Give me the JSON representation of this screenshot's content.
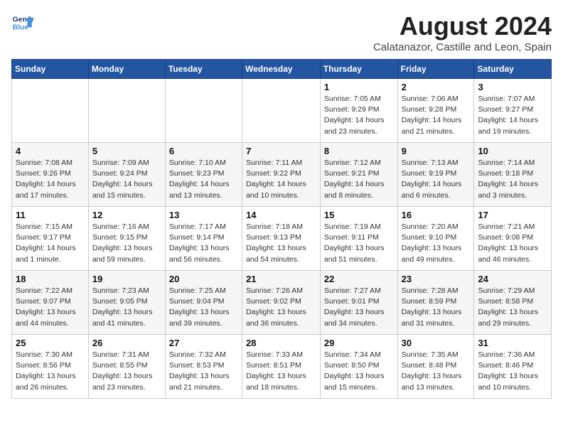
{
  "header": {
    "logo_line1": "General",
    "logo_line2": "Blue",
    "month_year": "August 2024",
    "location": "Calatanazor, Castille and Leon, Spain"
  },
  "weekdays": [
    "Sunday",
    "Monday",
    "Tuesday",
    "Wednesday",
    "Thursday",
    "Friday",
    "Saturday"
  ],
  "weeks": [
    [
      {
        "day": "",
        "info": ""
      },
      {
        "day": "",
        "info": ""
      },
      {
        "day": "",
        "info": ""
      },
      {
        "day": "",
        "info": ""
      },
      {
        "day": "1",
        "info": "Sunrise: 7:05 AM\nSunset: 9:29 PM\nDaylight: 14 hours\nand 23 minutes."
      },
      {
        "day": "2",
        "info": "Sunrise: 7:06 AM\nSunset: 9:28 PM\nDaylight: 14 hours\nand 21 minutes."
      },
      {
        "day": "3",
        "info": "Sunrise: 7:07 AM\nSunset: 9:27 PM\nDaylight: 14 hours\nand 19 minutes."
      }
    ],
    [
      {
        "day": "4",
        "info": "Sunrise: 7:08 AM\nSunset: 9:26 PM\nDaylight: 14 hours\nand 17 minutes."
      },
      {
        "day": "5",
        "info": "Sunrise: 7:09 AM\nSunset: 9:24 PM\nDaylight: 14 hours\nand 15 minutes."
      },
      {
        "day": "6",
        "info": "Sunrise: 7:10 AM\nSunset: 9:23 PM\nDaylight: 14 hours\nand 13 minutes."
      },
      {
        "day": "7",
        "info": "Sunrise: 7:11 AM\nSunset: 9:22 PM\nDaylight: 14 hours\nand 10 minutes."
      },
      {
        "day": "8",
        "info": "Sunrise: 7:12 AM\nSunset: 9:21 PM\nDaylight: 14 hours\nand 8 minutes."
      },
      {
        "day": "9",
        "info": "Sunrise: 7:13 AM\nSunset: 9:19 PM\nDaylight: 14 hours\nand 6 minutes."
      },
      {
        "day": "10",
        "info": "Sunrise: 7:14 AM\nSunset: 9:18 PM\nDaylight: 14 hours\nand 3 minutes."
      }
    ],
    [
      {
        "day": "11",
        "info": "Sunrise: 7:15 AM\nSunset: 9:17 PM\nDaylight: 14 hours\nand 1 minute."
      },
      {
        "day": "12",
        "info": "Sunrise: 7:16 AM\nSunset: 9:15 PM\nDaylight: 13 hours\nand 59 minutes."
      },
      {
        "day": "13",
        "info": "Sunrise: 7:17 AM\nSunset: 9:14 PM\nDaylight: 13 hours\nand 56 minutes."
      },
      {
        "day": "14",
        "info": "Sunrise: 7:18 AM\nSunset: 9:13 PM\nDaylight: 13 hours\nand 54 minutes."
      },
      {
        "day": "15",
        "info": "Sunrise: 7:19 AM\nSunset: 9:11 PM\nDaylight: 13 hours\nand 51 minutes."
      },
      {
        "day": "16",
        "info": "Sunrise: 7:20 AM\nSunset: 9:10 PM\nDaylight: 13 hours\nand 49 minutes."
      },
      {
        "day": "17",
        "info": "Sunrise: 7:21 AM\nSunset: 9:08 PM\nDaylight: 13 hours\nand 46 minutes."
      }
    ],
    [
      {
        "day": "18",
        "info": "Sunrise: 7:22 AM\nSunset: 9:07 PM\nDaylight: 13 hours\nand 44 minutes."
      },
      {
        "day": "19",
        "info": "Sunrise: 7:23 AM\nSunset: 9:05 PM\nDaylight: 13 hours\nand 41 minutes."
      },
      {
        "day": "20",
        "info": "Sunrise: 7:25 AM\nSunset: 9:04 PM\nDaylight: 13 hours\nand 39 minutes."
      },
      {
        "day": "21",
        "info": "Sunrise: 7:26 AM\nSunset: 9:02 PM\nDaylight: 13 hours\nand 36 minutes."
      },
      {
        "day": "22",
        "info": "Sunrise: 7:27 AM\nSunset: 9:01 PM\nDaylight: 13 hours\nand 34 minutes."
      },
      {
        "day": "23",
        "info": "Sunrise: 7:28 AM\nSunset: 8:59 PM\nDaylight: 13 hours\nand 31 minutes."
      },
      {
        "day": "24",
        "info": "Sunrise: 7:29 AM\nSunset: 8:58 PM\nDaylight: 13 hours\nand 29 minutes."
      }
    ],
    [
      {
        "day": "25",
        "info": "Sunrise: 7:30 AM\nSunset: 8:56 PM\nDaylight: 13 hours\nand 26 minutes."
      },
      {
        "day": "26",
        "info": "Sunrise: 7:31 AM\nSunset: 8:55 PM\nDaylight: 13 hours\nand 23 minutes."
      },
      {
        "day": "27",
        "info": "Sunrise: 7:32 AM\nSunset: 8:53 PM\nDaylight: 13 hours\nand 21 minutes."
      },
      {
        "day": "28",
        "info": "Sunrise: 7:33 AM\nSunset: 8:51 PM\nDaylight: 13 hours\nand 18 minutes."
      },
      {
        "day": "29",
        "info": "Sunrise: 7:34 AM\nSunset: 8:50 PM\nDaylight: 13 hours\nand 15 minutes."
      },
      {
        "day": "30",
        "info": "Sunrise: 7:35 AM\nSunset: 8:48 PM\nDaylight: 13 hours\nand 13 minutes."
      },
      {
        "day": "31",
        "info": "Sunrise: 7:36 AM\nSunset: 8:46 PM\nDaylight: 13 hours\nand 10 minutes."
      }
    ]
  ]
}
